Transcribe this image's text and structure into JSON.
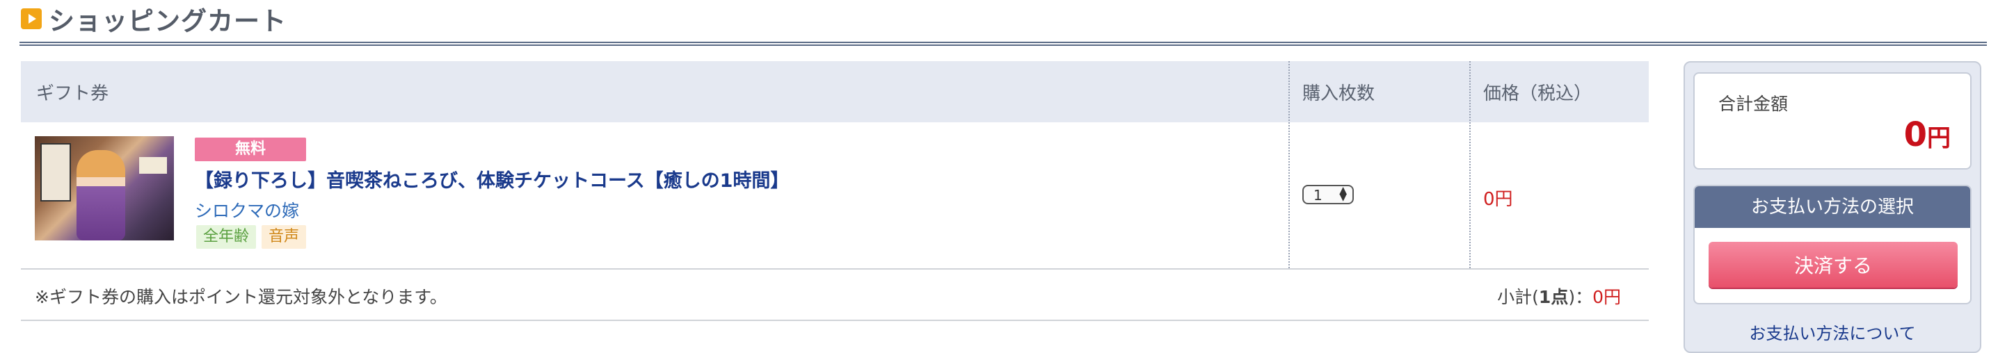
{
  "header": {
    "title": "ショッピングカート"
  },
  "cart": {
    "columns": {
      "item": "ギフト券",
      "quantity": "購入枚数",
      "price": "価格（税込）"
    },
    "items": [
      {
        "badge": "無料",
        "title": "【録り下ろし】音喫茶ねころび、体験チケットコース【癒しの1時間】",
        "maker": "シロクマの嫁",
        "tags": [
          "全年齢",
          "音声"
        ],
        "quantity": "1",
        "price": "0円"
      }
    ],
    "note": "※ギフト券の購入はポイント還元対象外となります。",
    "subtotal": {
      "label_before": "小計(",
      "count": "1点",
      "label_after": ")：",
      "amount": "0円"
    }
  },
  "summary": {
    "total_label": "合計金額",
    "total_amount": "0",
    "total_unit": "円",
    "payment_header": "お支払い方法の選択",
    "checkout_label": "決済する",
    "payment_about": "お支払い方法について"
  },
  "colors": {
    "accent_red": "#d02020",
    "checkout_pink": "#e8506a",
    "header_navy": "#5e6f92",
    "free_badge": "#ef7aa0"
  },
  "icons": {
    "header": "play-square-icon",
    "quantity": "stepper-arrows-icon"
  }
}
